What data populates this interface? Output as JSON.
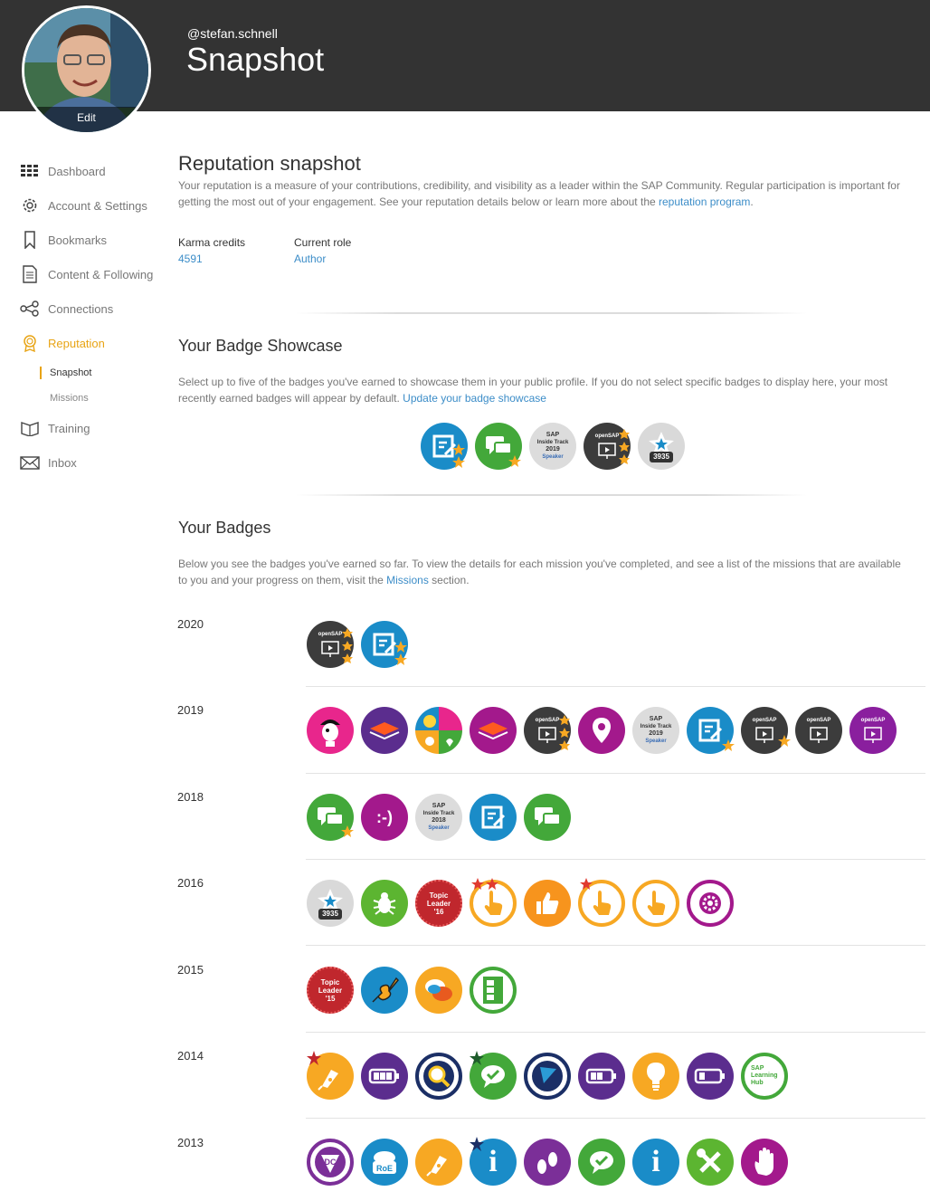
{
  "header": {
    "handle": "@stefan.schnell",
    "title": "Snapshot",
    "avatar_edit": "Edit"
  },
  "sidebar": {
    "items": [
      {
        "label": "Dashboard",
        "icon": "grid-icon"
      },
      {
        "label": "Account & Settings",
        "icon": "gear-icon"
      },
      {
        "label": "Bookmarks",
        "icon": "bookmark-icon"
      },
      {
        "label": "Content & Following",
        "icon": "document-icon"
      },
      {
        "label": "Connections",
        "icon": "share-icon"
      },
      {
        "label": "Reputation",
        "icon": "ribbon-icon"
      }
    ],
    "subitems": [
      {
        "label": "Snapshot"
      },
      {
        "label": "Missions"
      }
    ],
    "items2": [
      {
        "label": "Training",
        "icon": "book-icon"
      },
      {
        "label": "Inbox",
        "icon": "envelope-icon"
      }
    ]
  },
  "reputation": {
    "title": "Reputation snapshot",
    "text": "Your reputation is a measure of your contributions, credibility, and visibility as a leader within the SAP Community. Regular participation is important for getting the most out of your engagement. See your reputation details below or learn more about the",
    "link": "reputation program",
    "after": ".",
    "karma_label": "Karma credits",
    "karma_value": "4591",
    "role_label": "Current role",
    "role_value": "Author"
  },
  "showcase": {
    "title": "Your Badge Showcase",
    "text": "Select up to five of the badges you've earned to showcase them in your public profile. If you do not select specific badges to display here, your most recently earned badges will appear by default.",
    "link": "Update your badge showcase"
  },
  "badges_section": {
    "title": "Your Badges",
    "text": "Below you see the badges you've earned so far. To view the details for each mission you've completed, and see a list of the missions that are available to you and your progress on them, visit the",
    "link": "Missions",
    "after": "section."
  },
  "badge_texts": {
    "opensap": "openSAP",
    "sap": "SAP",
    "inside": "Inside Track",
    "y2019": "2019",
    "y2018": "2018",
    "speaker": "Speaker",
    "count": "3935",
    "topic": "Topic",
    "leader": "Leader",
    "t16": "'16",
    "t15": "'15",
    "smiley": ":-)",
    "roe": "RoE",
    "dc": "DC",
    "info": "i",
    "hub1": "SAP",
    "hub2": "Learning",
    "hub3": "Hub"
  },
  "years": [
    "2020",
    "2019",
    "2018",
    "2016",
    "2015",
    "2014",
    "2013"
  ],
  "colors": {
    "header_bg": "#333333",
    "accent": "#e8a415",
    "link": "#3c8dc8"
  }
}
